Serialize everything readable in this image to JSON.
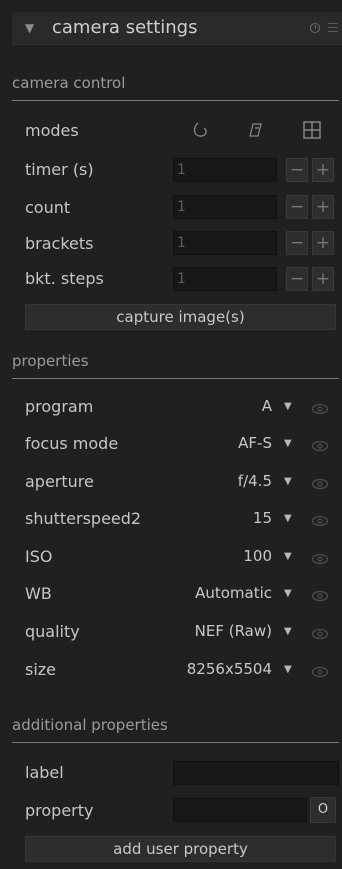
{
  "header": {
    "title": "camera settings",
    "collapse_icon": "triangle-down-icon",
    "reset_icon": "reset-icon",
    "presets_icon": "presets-menu-icon"
  },
  "camera_control": {
    "title": "camera control",
    "modes_label": "modes",
    "mode_icons": [
      "timelapse-icon",
      "bracket-icon",
      "grid-icon"
    ],
    "fields": [
      {
        "label": "timer (s)",
        "value": "1",
        "minus": "−",
        "plus": "+"
      },
      {
        "label": "count",
        "value": "1",
        "minus": "−",
        "plus": "+"
      },
      {
        "label": "brackets",
        "value": "1",
        "minus": "−",
        "plus": "+"
      },
      {
        "label": "bkt. steps",
        "value": "1",
        "minus": "−",
        "plus": "+"
      }
    ],
    "capture_label": "capture image(s)"
  },
  "properties": {
    "title": "properties",
    "items": [
      {
        "label": "program",
        "value": "A",
        "arrow": "▼"
      },
      {
        "label": "focus mode",
        "value": "AF-S",
        "arrow": "▼"
      },
      {
        "label": "aperture",
        "value": "f/4.5",
        "arrow": "▼"
      },
      {
        "label": "shutterspeed2",
        "value": "15",
        "arrow": "▼"
      },
      {
        "label": "ISO",
        "value": "100",
        "arrow": "▼"
      },
      {
        "label": "WB",
        "value": "Automatic",
        "arrow": "▼"
      },
      {
        "label": "quality",
        "value": "NEF (Raw)",
        "arrow": "▼"
      },
      {
        "label": "size",
        "value": "8256x5504",
        "arrow": "▼"
      }
    ]
  },
  "additional": {
    "title": "additional properties",
    "label_label": "label",
    "label_value": "",
    "property_label": "property",
    "property_value": "",
    "o_label": "O",
    "add_label": "add user property"
  },
  "colors": {
    "background": "#202020",
    "header": "#2a2a2a",
    "field": "#171717",
    "text": "#c8c8c8",
    "muted": "#9a9a9a"
  }
}
